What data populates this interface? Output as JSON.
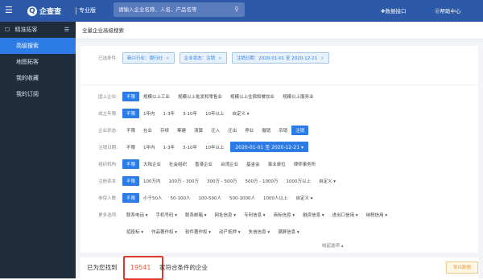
{
  "topbar": {
    "menu_glyph": "☰",
    "logo_glyph": "Q",
    "logo_text": "企查查",
    "edition": "专业版",
    "search_placeholder": "请输入企业名称、人名、产品名等",
    "data_api": "✚数据接口",
    "help": "⓪帮助中心"
  },
  "sidebar": {
    "head_icon": "☐",
    "head_label": "精准拓客",
    "toggle_glyph": "☰",
    "items": [
      {
        "label": "高级搜索",
        "active": true
      },
      {
        "label": "地图拓客",
        "active": false
      },
      {
        "label": "我的收藏",
        "active": false
      },
      {
        "label": "我的订阅",
        "active": false
      }
    ]
  },
  "breadcrumb": "全量企业高级搜索",
  "filters": {
    "selected_label": "已选条件:",
    "chips": [
      "新兴行业：银行社",
      "企业状态：注销",
      "注销日期：2020-01-01 至 2020-12-21"
    ],
    "chip_close": "×",
    "rows": [
      {
        "label": "国上企业:",
        "options": [
          "不限",
          "规模以上工业",
          "规模以上批发和零售业",
          "规模以上住宿和餐饮业",
          "规模以上服务业"
        ],
        "selected": 0
      },
      {
        "label": "成立年限:",
        "options": [
          "不限",
          "1年内",
          "1-3年",
          "3-10年",
          "10年以上",
          "自定义 ▾"
        ],
        "selected": 0
      },
      {
        "label": "企业状态:",
        "options": [
          "不限",
          "在业",
          "存续",
          "筹建",
          "清算",
          "迁入",
          "迁出",
          "停业",
          "撤销",
          "吊销",
          "注销"
        ],
        "selected": 10
      },
      {
        "label": "注销日期:",
        "options": [
          "不限",
          "1年内",
          "1-3年",
          "3-10年",
          "10年以上"
        ],
        "selected": -1,
        "date_range": "2020-01-01 至 2020-12-21 ▾"
      },
      {
        "label": "组织机构:",
        "options": [
          "不限",
          "大陆企业",
          "社会组织",
          "香港企业",
          "台湾企业",
          "基金会",
          "事业单位",
          "律师事务所"
        ],
        "selected": 0
      },
      {
        "label": "注册资本:",
        "options": [
          "不限",
          "100万内",
          "100万 - 300万",
          "300万 - 500万",
          "500万 - 1000万",
          "1000万以上",
          "自定义 ▾"
        ],
        "selected": 0
      },
      {
        "label": "参保人数:",
        "options": [
          "不限",
          "小于50人",
          "50-100人",
          "100-500人",
          "500-1000人",
          "1000人以上",
          "自定义 ▾"
        ],
        "selected": 0
      },
      {
        "label": "更多选项:",
        "options": [
          "联系电话 ▾",
          "手机号码 ▾",
          "联系邮箱 ▾",
          "网址信息 ▾",
          "专利信息 ▾",
          "商标信息 ▾",
          "融资信息 ▾",
          "进出口信用 ▾",
          "纳税信用 ▾"
        ],
        "selected": -1
      },
      {
        "label": "",
        "options": [
          "招投标 ▾",
          "作品著作权 ▾",
          "软件著作权 ▾",
          "动产抵押 ▾",
          "失信信息 ▾",
          "满屏信息 ▾"
        ],
        "selected": -1
      }
    ],
    "collapse": "收起选项 ▴"
  },
  "result": {
    "prefix": "已为您找到",
    "count": "19541",
    "suffix": "家符合条件的企业",
    "right_button": "导出数据"
  }
}
